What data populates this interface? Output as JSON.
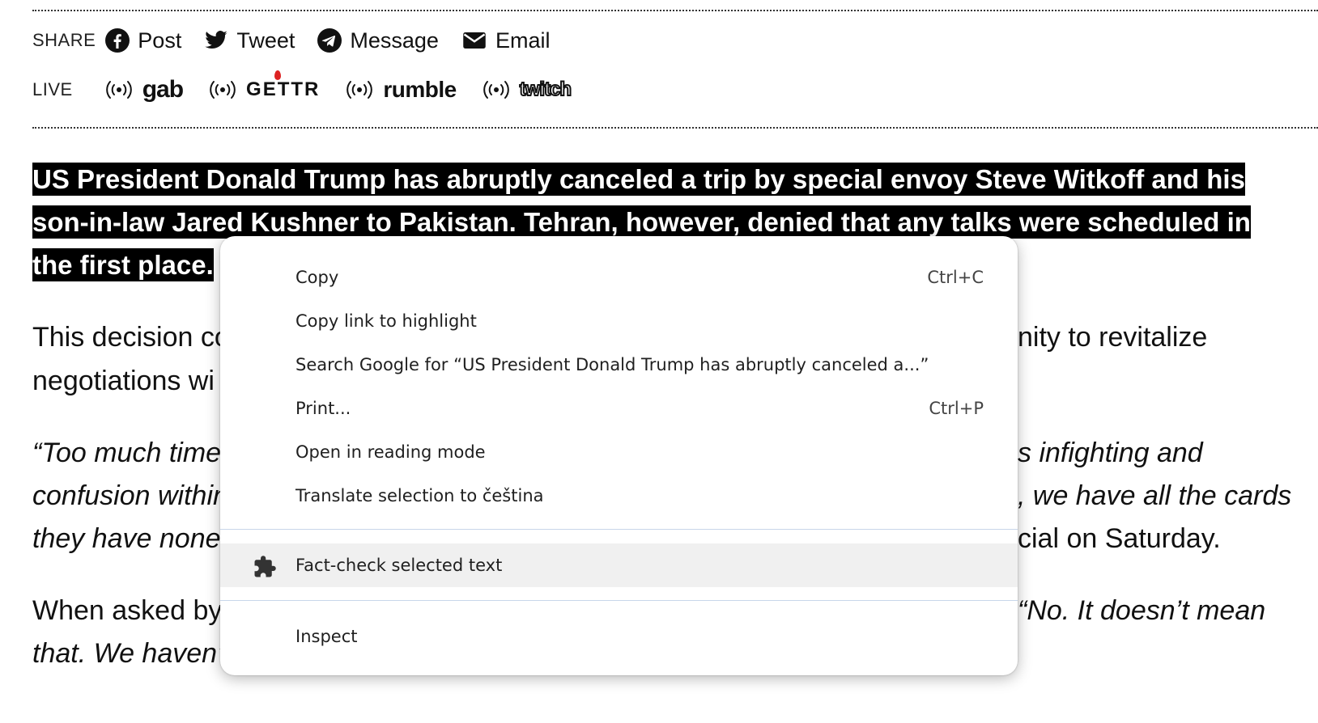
{
  "share": {
    "label": "SHARE",
    "items": [
      {
        "label": "Post",
        "icon": "facebook-icon"
      },
      {
        "label": "Tweet",
        "icon": "twitter-icon"
      },
      {
        "label": "Message",
        "icon": "telegram-icon"
      },
      {
        "label": "Email",
        "icon": "email-icon"
      }
    ]
  },
  "live": {
    "label": "LIVE",
    "platforms": [
      "gab",
      "GETTR",
      "rumble",
      "twitch"
    ]
  },
  "article": {
    "lead_line1": "US President Donald Trump has abruptly canceled a trip by special envoy Steve Witkoff and his",
    "lead_line2": "son-in-law Jared Kushner to Pakistan. Tehran, however, denied that any talks were scheduled in",
    "lead_line3": "the first place.",
    "p1_left1": "This decision co",
    "p1_right1": "nity to revitalize",
    "p1_left2": "negotiations wi",
    "p2_left1": "“Too much time w",
    "p2_right1": "s infighting and",
    "p2_left2": "confusion within",
    "p2_right2": ", we have all the cards",
    "p2_left3": "they have none!",
    "p2_right3": "cial on Saturday.",
    "p3_left1": "When asked by",
    "p3_right1": "“No. It doesn’t mean",
    "p3_left2": "that. We haven’t"
  },
  "context_menu": {
    "items": [
      {
        "label": "Copy",
        "shortcut": "Ctrl+C"
      },
      {
        "label": "Copy link to highlight",
        "shortcut": ""
      },
      {
        "label": "Search Google for “US President Donald Trump has abruptly canceled a...”",
        "shortcut": ""
      },
      {
        "label": "Print...",
        "shortcut": "Ctrl+P"
      },
      {
        "label": "Open in reading mode",
        "shortcut": ""
      },
      {
        "label": "Translate selection to čeština",
        "shortcut": ""
      }
    ],
    "extension_item": {
      "label": "Fact-check selected text",
      "icon": "puzzle-icon"
    },
    "inspect": {
      "label": "Inspect"
    }
  }
}
